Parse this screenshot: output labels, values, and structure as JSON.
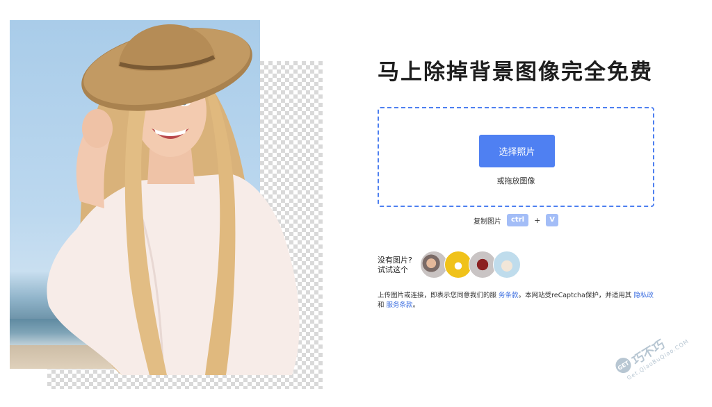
{
  "main": {
    "title": "马上除掉背景图像完全免费",
    "upload": {
      "button_label": "选择照片",
      "drop_hint": "或拖放图像"
    },
    "paste": {
      "label": "复制图片",
      "key1": "ctrl",
      "plus": "+",
      "key2": "V"
    },
    "samples": {
      "label_line1": "没有图片?",
      "label_line2": "试试这个"
    },
    "terms": {
      "text_before": "上传图片或连接，即表示您同意我们的服",
      "link_terms": "务条款",
      "text_mid": "。本网站受reCaptcha保护，并适用其",
      "link_privacy": "隐私政",
      "text_and": "和",
      "link_service": "服务条款",
      "text_end": "。"
    }
  },
  "watermark": {
    "badge": "GET",
    "text": "巧不巧",
    "url": "Get.QiaoBuQiao.COM"
  },
  "colors": {
    "accent": "#4f80f2",
    "dropzone_border": "#4d7ff0",
    "key_bg": "#a3bdf7",
    "link": "#3d6fe0"
  }
}
